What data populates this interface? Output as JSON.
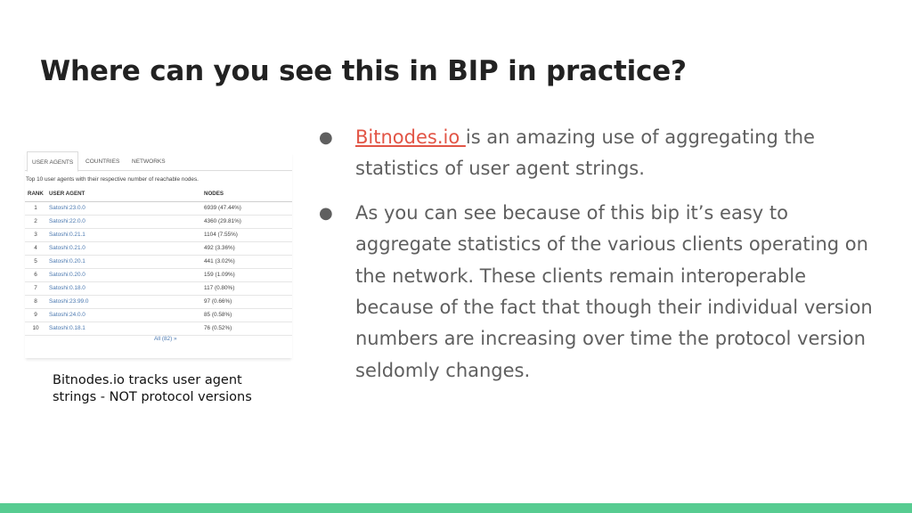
{
  "slide": {
    "title": "Where can you see this in BIP in practice?",
    "footer_color": "#57cc91",
    "accent_link_color": "#e25546"
  },
  "screenshot": {
    "tabs": [
      "USER AGENTS",
      "COUNTRIES",
      "NETWORKS"
    ],
    "active_tab": "USER AGENTS",
    "caption": "Top 10 user agents with their respective number of reachable nodes.",
    "columns": [
      "RANK",
      "USER AGENT",
      "NODES"
    ],
    "rows": [
      [
        "1",
        "Satoshi:23.0.0",
        "6939 (47.44%)"
      ],
      [
        "2",
        "Satoshi:22.0.0",
        "4360 (29.81%)"
      ],
      [
        "3",
        "Satoshi:0.21.1",
        "1104 (7.55%)"
      ],
      [
        "4",
        "Satoshi:0.21.0",
        "492 (3.36%)"
      ],
      [
        "5",
        "Satoshi:0.20.1",
        "441 (3.02%)"
      ],
      [
        "6",
        "Satoshi:0.20.0",
        "159 (1.09%)"
      ],
      [
        "7",
        "Satoshi:0.18.0",
        "117 (0.80%)"
      ],
      [
        "8",
        "Satoshi:23.99.0",
        "97 (0.66%)"
      ],
      [
        "9",
        "Satoshi:24.0.0",
        "85 (0.58%)"
      ],
      [
        "10",
        "Satoshi:0.18.1",
        "76 (0.52%)"
      ]
    ],
    "all_link": "All (82) »"
  },
  "image_caption": "Bitnodes.io tracks user agent strings - NOT protocol versions",
  "bullets": [
    {
      "marker": "●",
      "link_text": "Bitnodes.io ",
      "text": "is an amazing use of aggregating the statistics of user agent strings."
    },
    {
      "marker": "●",
      "text": "As you can see because of this bip it’s easy to aggregate statistics of the various clients operating on the network. These clients remain interoperable because of the fact that though their individual version numbers are increasing over time the protocol version seldomly changes."
    }
  ]
}
